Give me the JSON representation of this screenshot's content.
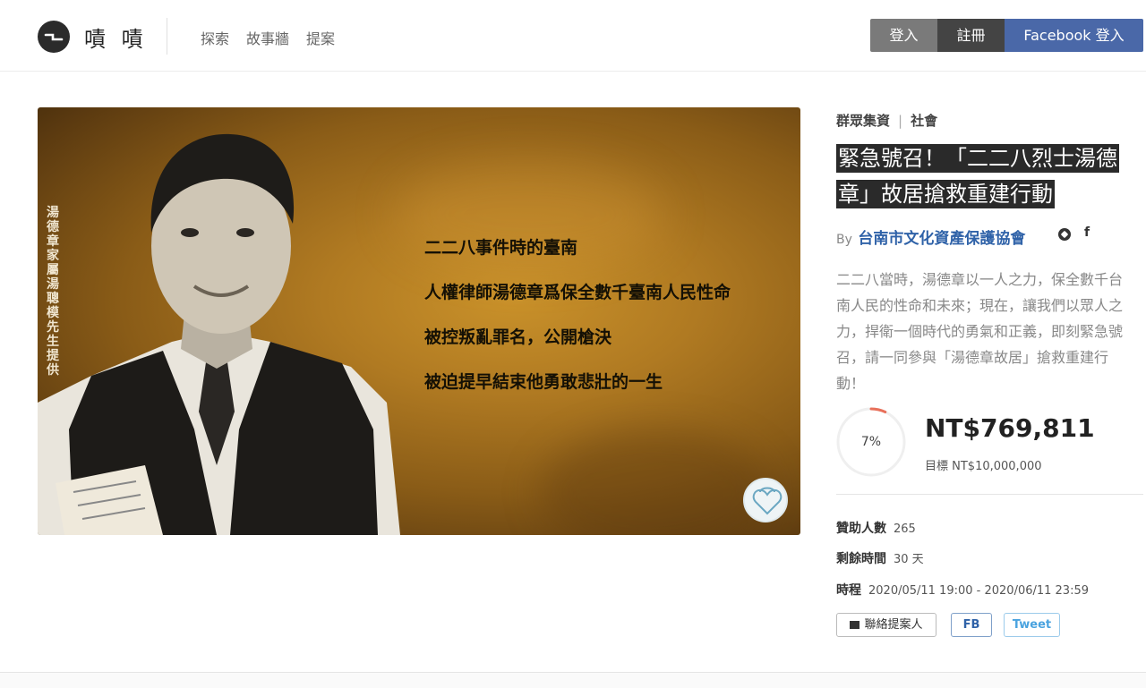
{
  "header": {
    "brand": "嘖 嘖",
    "nav": [
      "探索",
      "故事牆",
      "提案"
    ],
    "login": "登入",
    "register": "註冊",
    "facebook_login": "Facebook 登入"
  },
  "hero": {
    "side_credit": "湯德章家屬湯聰模先生提供",
    "quote": [
      "二二八事件時的臺南",
      "人權律師湯德章爲保全數千臺南人民性命",
      "被控叛亂罪名，公開槍決",
      "被迫提早結束他勇敢悲壯的一生"
    ]
  },
  "project": {
    "category": "群眾集資",
    "subcategory": "社會",
    "title": "緊急號召！「二二八烈士湯德章」故居搶救重建行動",
    "by_prefix": "By",
    "organizer": "台南市文化資產保護協會",
    "organizer_fb": "f",
    "description": "二二八當時，湯德章以一人之力，保全數千台南人民的性命和未來；現在，讓我們以眾人之力，捍衛一個時代的勇氣和正義，即刻緊急號召，請一同參與「湯德章故居」搶救重建行動！",
    "percent_label": "7%",
    "percent_value": 0.07,
    "amount": "NT$769,811",
    "goal": "目標 NT$10,000,000",
    "stats": {
      "backers_label": "贊助人數",
      "backers_value": "265",
      "remaining_label": "剩餘時間",
      "remaining_value": "30 天",
      "schedule_label": "時程",
      "schedule_value": "2020/05/11 19:00 - 2020/06/11 23:59"
    },
    "share": {
      "contact": "聯絡提案人",
      "fb": "FB",
      "tweet": "Tweet"
    }
  },
  "colors": {
    "accent_ring": "#e8705a",
    "facebook": "#4a68a8",
    "link": "#2f62a8"
  }
}
